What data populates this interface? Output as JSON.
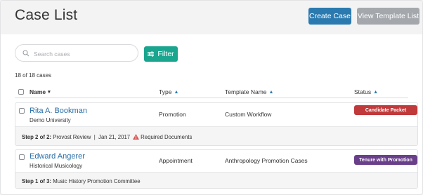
{
  "header": {
    "title": "Case List",
    "create_button": "Create Case",
    "view_template_button": "View Template List"
  },
  "toolbar": {
    "search_placeholder": "Search cases",
    "filter_label": "Filter"
  },
  "count_text": "18 of 18 cases",
  "columns": {
    "name": "Name",
    "type": "Type",
    "template": "Template Name",
    "status": "Status"
  },
  "cases": [
    {
      "name": "Rita A. Bookman",
      "department": "Demo University",
      "type": "Promotion",
      "template": "Custom Workflow",
      "status": "Candidate Packet",
      "status_color": "#c0393b",
      "step_label": "Step 2 of 2:",
      "step_detail": "Provost Review  |  Jan 21, 2017",
      "warning": "Required Documents"
    },
    {
      "name": "Edward Angerer",
      "department": "Historical Musicology",
      "type": "Appointment",
      "template": "Anthropology Promotion Cases",
      "status": "Tenure with Promotion",
      "status_color": "#6a3f8a",
      "step_label": "Step 1 of 3:",
      "step_detail": "Music History Promotion Committee"
    }
  ]
}
